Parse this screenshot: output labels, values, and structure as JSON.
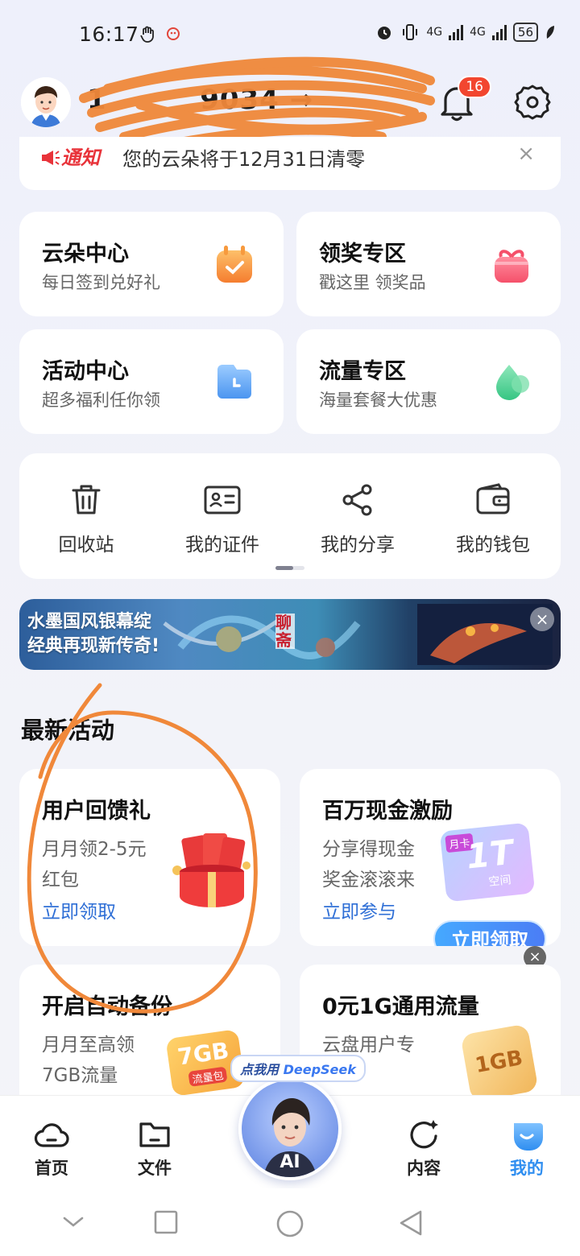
{
  "status": {
    "time": "16:17",
    "network_1": "4G",
    "network_2": "4G",
    "battery": "56"
  },
  "profile": {
    "phone": "1         9034 →",
    "notification_count": "16"
  },
  "notice": {
    "tag": "通知",
    "text": "您的云朵将于12月31日清零",
    "close": "×"
  },
  "feature_cards": [
    {
      "title": "云朵中心",
      "subtitle": "每日签到兑好礼",
      "icon": "calendar-check-icon",
      "color": "#f9a23b"
    },
    {
      "title": "领奖专区",
      "subtitle": "戳这里 领奖品",
      "icon": "gift-icon",
      "color": "#f3677d"
    },
    {
      "title": "活动中心",
      "subtitle": "超多福利任你领",
      "icon": "clock-icon",
      "color": "#5aa4f3"
    },
    {
      "title": "流量专区",
      "subtitle": "海量套餐大优惠",
      "icon": "droplet-icon",
      "color": "#4ed39a"
    }
  ],
  "tools": [
    {
      "label": "回收站",
      "icon": "trash-icon"
    },
    {
      "label": "我的证件",
      "icon": "id-card-icon"
    },
    {
      "label": "我的分享",
      "icon": "share-icon"
    },
    {
      "label": "我的钱包",
      "icon": "wallet-icon"
    }
  ],
  "banner": {
    "line1": "水墨国风银幕绽",
    "line2": "经典再现新传奇!",
    "seal": "聊斋",
    "close": "×"
  },
  "section_title": "最新活动",
  "activities": [
    {
      "title": "用户回馈礼",
      "line1": "月月领2-5元",
      "line2": "红包",
      "cta": "立即领取"
    },
    {
      "title": "百万现金激励",
      "line1": "分享得现金",
      "line2": "奖金滚滚来",
      "cta": "立即参与",
      "promo_badge": "立即领取",
      "tile_text": "1T",
      "tile_tag": "月卡",
      "tile_sub": "空间"
    },
    {
      "title": "开启自动备份",
      "line1": "月月至高领",
      "line2": "7GB流量",
      "deco": "7GB",
      "deco_sub": "流量包"
    },
    {
      "title": "0元1G通用流量",
      "line1": "云盘用户专",
      "deco": "1GB"
    }
  ],
  "fab": {
    "label_prefix": "点我用",
    "label_brand": "DeepSeek",
    "text": "AI"
  },
  "tabs": [
    {
      "label": "首页",
      "icon": "cloud-icon",
      "active": false
    },
    {
      "label": "文件",
      "icon": "folder-icon",
      "active": false
    },
    {
      "label": "内容",
      "icon": "refresh-sparkle-icon",
      "active": false
    },
    {
      "label": "我的",
      "icon": "smile-icon",
      "active": true
    }
  ],
  "colors": {
    "accent": "#2f8ef0",
    "link": "#2f6fd6",
    "notice_red": "#e8333a",
    "scribble_orange": "#f0883a"
  }
}
